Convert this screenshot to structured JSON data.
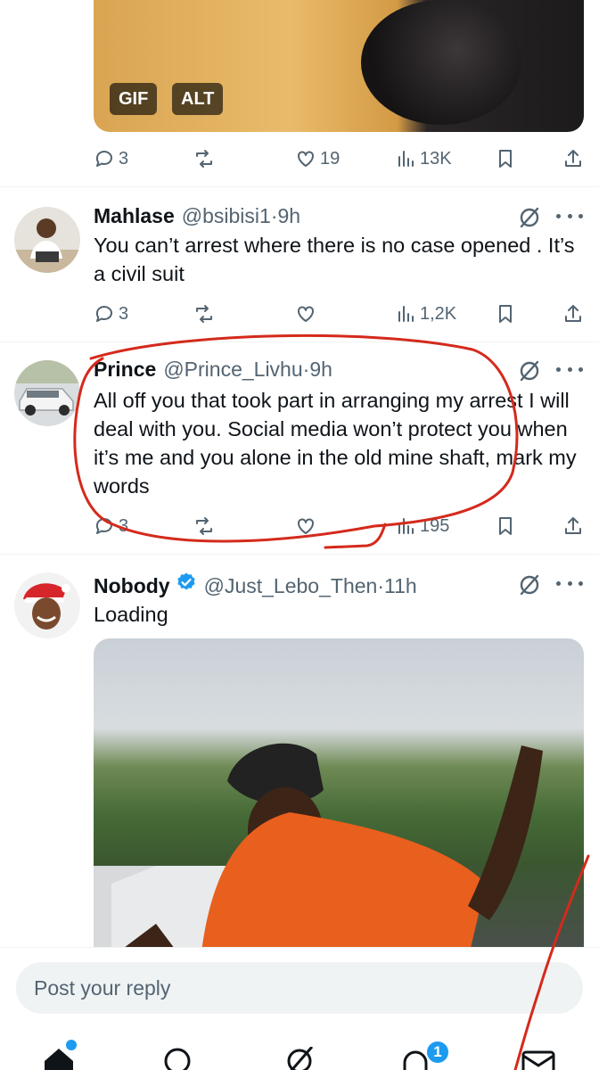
{
  "top_tweet": {
    "media": {
      "badges": [
        "GIF",
        "ALT"
      ]
    },
    "actions": {
      "replies": "3",
      "reposts": "",
      "likes": "19",
      "views": "13K"
    }
  },
  "tweets": [
    {
      "name": "Mahlase",
      "handle": "@bsibisi1",
      "separator": "·",
      "time": "9h",
      "text": "You can’t arrest where there is no case opened . It’s a civil suit",
      "actions": {
        "replies": "3",
        "reposts": "",
        "likes": "",
        "views": "1,2K"
      }
    },
    {
      "name": "Prince",
      "handle": "@Prince_Livhu",
      "separator": "·",
      "time": "9h",
      "text": "All off you that took part in arranging my arrest I will deal with you. Social media won’t protect you when it’s me and you alone in the old mine shaft, mark my words",
      "actions": {
        "replies": "3",
        "reposts": "",
        "likes": "",
        "views": "195"
      }
    },
    {
      "name": "Nobody",
      "handle": "@Just_Lebo_Then",
      "separator": "·",
      "time": "11h",
      "text": "Loading",
      "verified": true
    }
  ],
  "reply_bar": {
    "placeholder": "Post your reply"
  },
  "bottom_nav": {
    "items": [
      "home-icon",
      "search-icon",
      "grok-icon",
      "notifications-icon",
      "messages-icon"
    ],
    "notification_count": "1"
  },
  "colors": {
    "accent": "#1d9bf0",
    "text": "#0f1419",
    "secondary": "#536471",
    "annotation": "#d42a1c"
  }
}
